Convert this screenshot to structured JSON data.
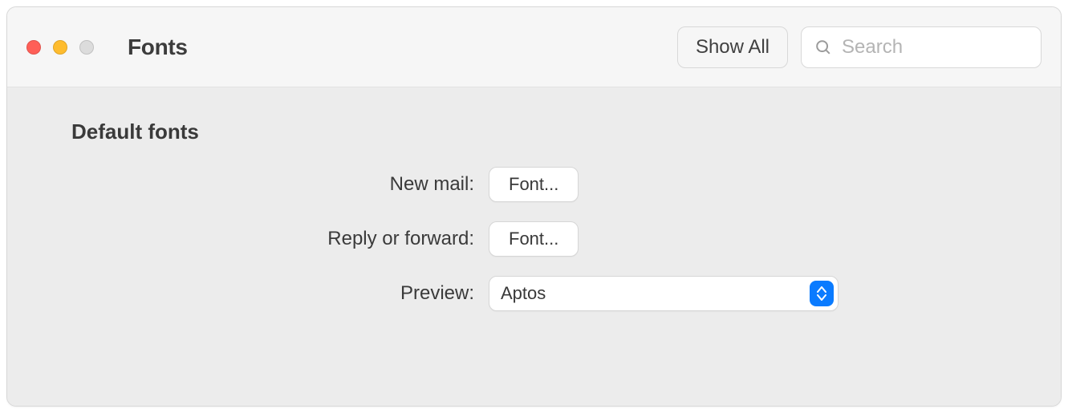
{
  "window": {
    "title": "Fonts"
  },
  "toolbar": {
    "show_all_label": "Show All",
    "search_placeholder": "Search"
  },
  "content": {
    "section_heading": "Default fonts",
    "rows": {
      "new_mail": {
        "label": "New mail:",
        "button": "Font..."
      },
      "reply_forward": {
        "label": "Reply or forward:",
        "button": "Font..."
      },
      "preview": {
        "label": "Preview:",
        "selected": "Aptos"
      }
    }
  }
}
